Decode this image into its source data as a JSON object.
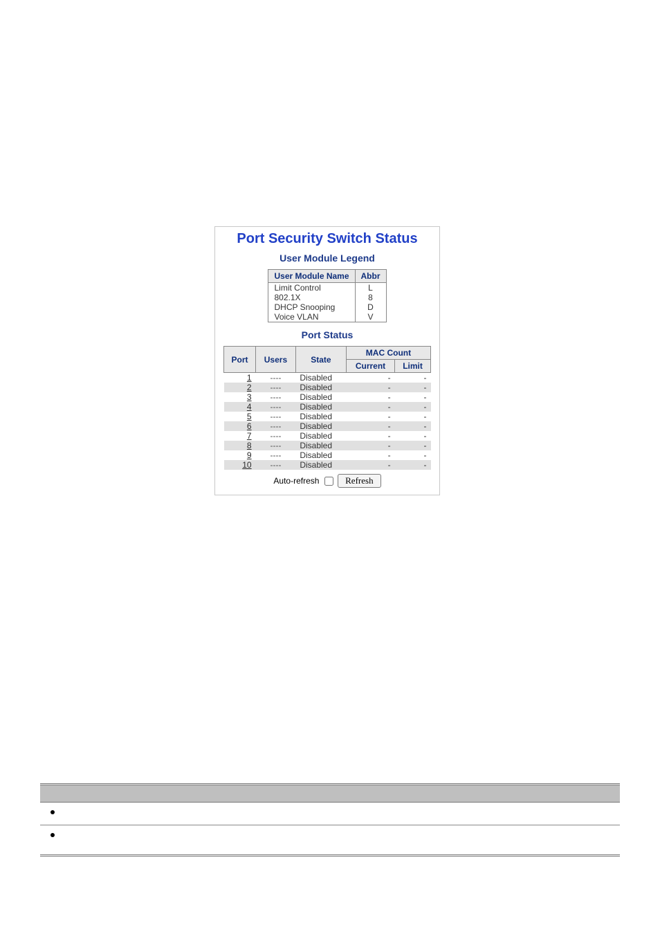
{
  "card": {
    "title": "Port Security Switch Status",
    "legend": {
      "heading": "User Module Legend",
      "headers": {
        "name": "User Module Name",
        "abbr": "Abbr"
      },
      "rows": [
        {
          "name": "Limit Control",
          "abbr": "L"
        },
        {
          "name": "802.1X",
          "abbr": "8"
        },
        {
          "name": "DHCP Snooping",
          "abbr": "D"
        },
        {
          "name": "Voice VLAN",
          "abbr": "V"
        }
      ]
    },
    "port_status": {
      "heading": "Port Status",
      "headers": {
        "port": "Port",
        "users": "Users",
        "state": "State",
        "mac_count": "MAC Count",
        "current": "Current",
        "limit": "Limit"
      },
      "rows": [
        {
          "port": "1",
          "users": "----",
          "state": "Disabled",
          "current": "-",
          "limit": "-"
        },
        {
          "port": "2",
          "users": "----",
          "state": "Disabled",
          "current": "-",
          "limit": "-"
        },
        {
          "port": "3",
          "users": "----",
          "state": "Disabled",
          "current": "-",
          "limit": "-"
        },
        {
          "port": "4",
          "users": "----",
          "state": "Disabled",
          "current": "-",
          "limit": "-"
        },
        {
          "port": "5",
          "users": "----",
          "state": "Disabled",
          "current": "-",
          "limit": "-"
        },
        {
          "port": "6",
          "users": "----",
          "state": "Disabled",
          "current": "-",
          "limit": "-"
        },
        {
          "port": "7",
          "users": "----",
          "state": "Disabled",
          "current": "-",
          "limit": "-"
        },
        {
          "port": "8",
          "users": "----",
          "state": "Disabled",
          "current": "-",
          "limit": "-"
        },
        {
          "port": "9",
          "users": "----",
          "state": "Disabled",
          "current": "-",
          "limit": "-"
        },
        {
          "port": "10",
          "users": "----",
          "state": "Disabled",
          "current": "-",
          "limit": "-"
        }
      ]
    },
    "controls": {
      "auto_refresh_label": "Auto-refresh",
      "refresh_button": "Refresh"
    }
  }
}
